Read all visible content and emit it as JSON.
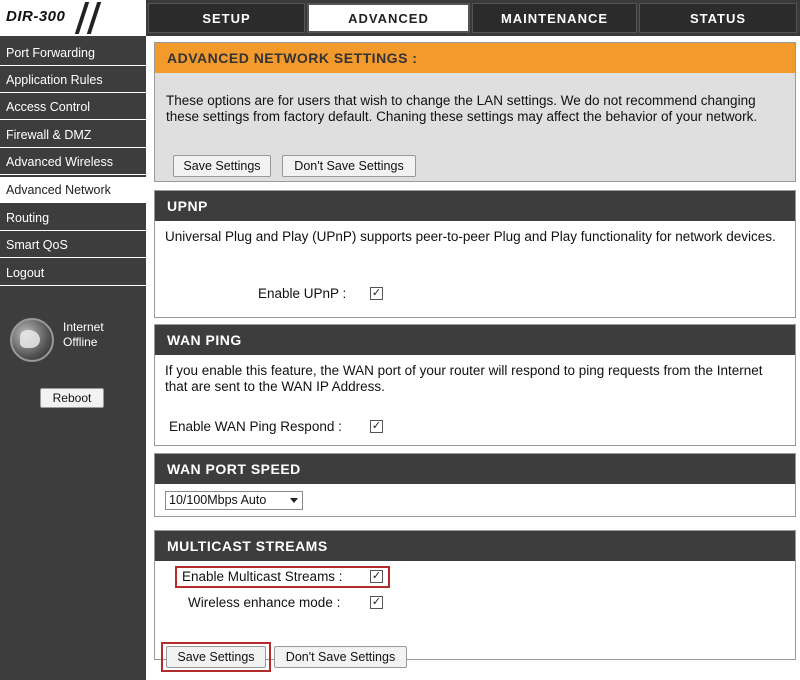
{
  "logo": {
    "text": "DIR-300"
  },
  "tabs": [
    {
      "label": "SETUP",
      "active": false
    },
    {
      "label": "ADVANCED",
      "active": true
    },
    {
      "label": "MAINTENANCE",
      "active": false
    },
    {
      "label": "STATUS",
      "active": false
    }
  ],
  "sidebar": {
    "items": [
      {
        "label": "Port Forwarding"
      },
      {
        "label": "Application Rules"
      },
      {
        "label": "Access Control"
      },
      {
        "label": "Firewall & DMZ"
      },
      {
        "label": "Advanced Wireless"
      },
      {
        "label": "Advanced Network",
        "active": true
      },
      {
        "label": "Routing"
      },
      {
        "label": "Smart QoS"
      },
      {
        "label": "Logout"
      }
    ],
    "internet_status_line1": "Internet",
    "internet_status_line2": "Offline",
    "reboot_label": "Reboot"
  },
  "advanced": {
    "title": "ADVANCED NETWORK SETTINGS :",
    "description": "These options are for users that wish to change the LAN settings. We do not recommend changing these settings from factory default. Chaning these settings may affect the behavior of your network.",
    "save_label": "Save Settings",
    "dont_save_label": "Don't Save Settings"
  },
  "upnp": {
    "title": "UPNP",
    "description": "Universal Plug and Play (UPnP) supports peer-to-peer Plug and Play functionality for network devices.",
    "enable_label": "Enable UPnP :",
    "enabled": true
  },
  "wan_ping": {
    "title": "WAN PING",
    "description": "If you enable this feature, the WAN port of your router will respond to ping requests from the Internet that are sent to the WAN IP Address.",
    "enable_label": "Enable WAN Ping Respond :",
    "enabled": true
  },
  "wan_port_speed": {
    "title": "WAN PORT SPEED",
    "selected": "10/100Mbps Auto"
  },
  "multicast": {
    "title": "MULTICAST STREAMS",
    "enable_label": "Enable Multicast Streams :",
    "enabled": true,
    "wireless_label": "Wireless enhance mode :",
    "wireless_enabled": true
  },
  "footer": {
    "save_label": "Save Settings",
    "dont_save_label": "Don't Save Settings"
  },
  "colors": {
    "header_orange": "#f39a2c",
    "dark_gray": "#3d3d3d",
    "highlight_red": "#b32b2b"
  }
}
